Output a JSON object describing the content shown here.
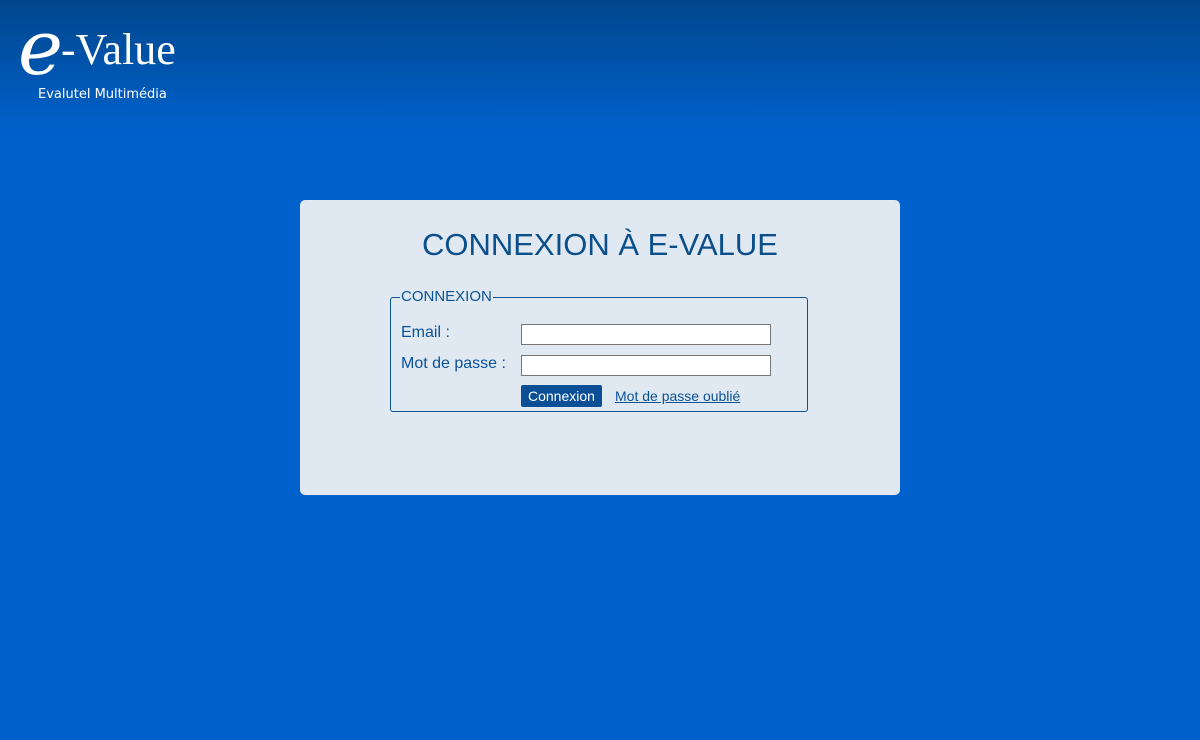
{
  "brand": {
    "logo_e": "e",
    "logo_value": "-Value",
    "tagline": "Evalutel Multimédia"
  },
  "login_card": {
    "title": "CONNEXION À E-VALUE",
    "fieldset_legend": "CONNEXION",
    "email_label": "Email :",
    "email_value": "",
    "password_label": "Mot de passe :",
    "password_value": "",
    "submit_label": "Connexion",
    "forgot_password_link": "Mot de passe oublié"
  },
  "colors": {
    "background": "#0060cc",
    "card_background": "#e0e8f2",
    "accent": "#0a4f96"
  }
}
